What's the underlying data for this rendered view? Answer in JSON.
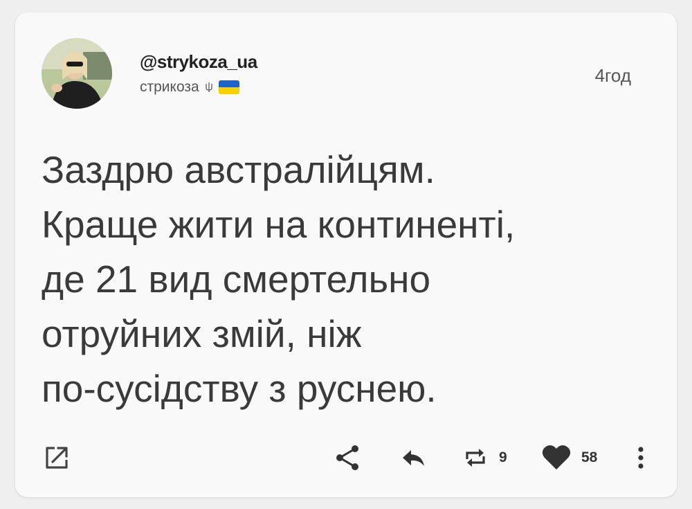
{
  "post": {
    "username": "@strykoza_ua",
    "display_name": "стрикоза",
    "time": "4год",
    "text_lines": [
      "Заздрю австралійцям.",
      "Краще жити на континенті,",
      "де 21 вид смертельно",
      "отруйних змій, ніж",
      "по-сусідству з руснею."
    ]
  },
  "icons": {
    "open": "open-external-icon",
    "share": "share-icon",
    "reply": "reply-icon",
    "repost": "repost-icon",
    "like": "heart-icon",
    "more": "more-vertical-icon",
    "badge_trident": "trident-icon",
    "badge_flag": "ukraine-flag-icon"
  },
  "stats": {
    "reposts": "9",
    "likes": "58"
  },
  "colors": {
    "card": "#f9f9f9",
    "background": "#efefef",
    "text": "#3a3a3a",
    "flag_blue": "#1e64c8",
    "flag_yellow": "#f7d000"
  }
}
